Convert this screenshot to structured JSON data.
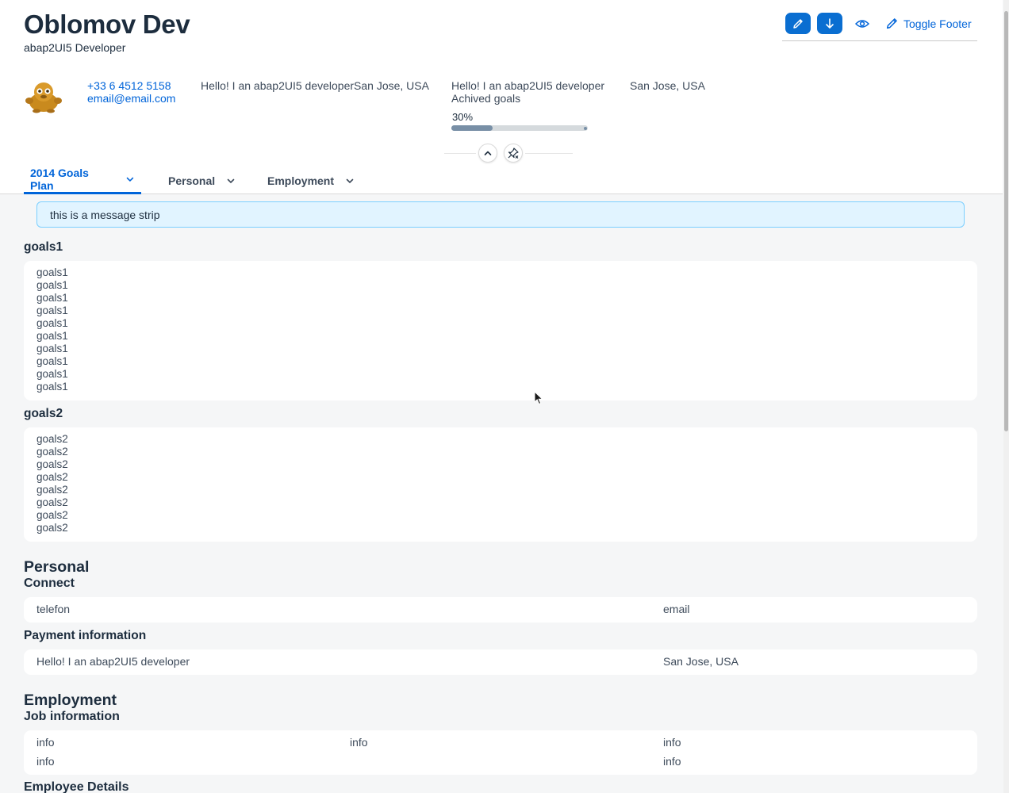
{
  "header": {
    "title": "Oblomov Dev",
    "subtitle": "abap2UI5 Developer",
    "toggle_footer_label": "Toggle Footer",
    "phone": "+33 6 4512 5158",
    "email": "email@email.com",
    "text_combined": "Hello! I an abap2UI5 developerSan Jose, USA",
    "text_intro": "Hello! I an abap2UI5 developer",
    "achieved_label": "Achived goals",
    "location": "San Jose, USA",
    "progress_label": "30%",
    "progress_value": 0.3
  },
  "tabs": [
    {
      "label": "2014 Goals Plan",
      "active": true
    },
    {
      "label": "Personal",
      "active": false
    },
    {
      "label": "Employment",
      "active": false
    }
  ],
  "message_strip": "this is a message strip",
  "goals1": {
    "title": "goals1",
    "items": [
      "goals1",
      "goals1",
      "goals1",
      "goals1",
      "goals1",
      "goals1",
      "goals1",
      "goals1",
      "goals1",
      "goals1"
    ]
  },
  "goals2": {
    "title": "goals2",
    "items": [
      "goals2",
      "goals2",
      "goals2",
      "goals2",
      "goals2",
      "goals2",
      "goals2",
      "goals2"
    ]
  },
  "personal": {
    "title": "Personal",
    "connect_title": "Connect",
    "connect_left": "telefon",
    "connect_right": "email",
    "payment_title": "Payment information",
    "payment_left": "Hello! I an abap2UI5 developer",
    "payment_right": "San Jose, USA"
  },
  "employment": {
    "title": "Employment",
    "job_title": "Job information",
    "job_rows": [
      [
        "info",
        "info",
        "info"
      ],
      [
        "info",
        "",
        "info"
      ]
    ],
    "employee_details_title": "Employee Details"
  },
  "colors": {
    "accent": "#0a6ed1",
    "link": "#0064d9",
    "message_strip_bg": "#e1f4ff",
    "progress_fill": "#788fa6"
  },
  "icons": {
    "edit": "pencil-icon",
    "download": "arrow-down-icon",
    "view": "eye-icon",
    "collapse": "chevron-up-icon",
    "unpin": "pin-slash-icon",
    "tab_dropdown": "chevron-down-icon"
  }
}
